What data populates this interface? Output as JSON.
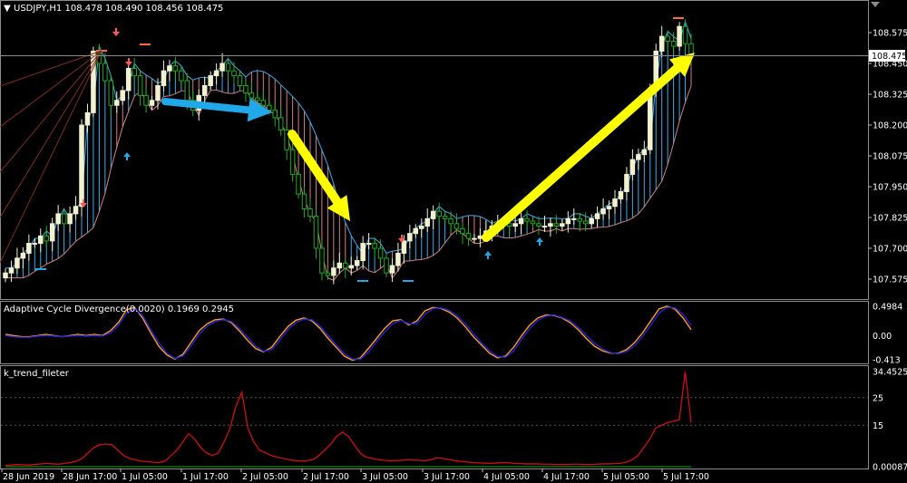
{
  "main": {
    "header": "USDJPY,H1  108.478 108.490 108.456 108.475",
    "price_tag": "108.475",
    "y_ticks": [
      "108.575",
      "108.450",
      "108.325",
      "108.200",
      "108.075",
      "107.950",
      "107.825",
      "107.700",
      "107.575"
    ]
  },
  "acd": {
    "header": "Adaptive Cycle Divergence(0.0020) 0.1969 0.2945",
    "y_ticks": [
      "0.4984",
      "0.00",
      "-0.413"
    ]
  },
  "trend": {
    "header": "k_trend_fileter",
    "y_ticks": [
      "34.4525",
      "25",
      "15",
      "0.00087"
    ]
  },
  "x_ticks": [
    "28 Jun 2019",
    "28 Jun 17:00",
    "1 Jul 05:00",
    "1 Jul 17:00",
    "2 Jul 05:00",
    "2 Jul 17:00",
    "3 Jul 05:00",
    "3 Jul 17:00",
    "4 Jul 05:00",
    "4 Jul 17:00",
    "5 Jul 05:00",
    "5 Jul 17:00"
  ],
  "colors": {
    "background": "#000000",
    "grid": "#646464",
    "text": "#ffffff",
    "bull_candle": "#f2f2d0",
    "bear_candle": "#22aa22",
    "cloud_bull": "#3fa9e6",
    "cloud_bear": "#d08080",
    "acd_fast": "#ff9f1a",
    "acd_slow": "#2222dd",
    "trend_line": "#cc1111",
    "trend_base": "#118811",
    "arrow_blue": "#20a8e8",
    "arrow_yellow": "#ffff00"
  },
  "chart_data": [
    {
      "type": "candlestick",
      "title": "USDJPY,H1",
      "last_price": 108.475,
      "ylim": [
        107.53,
        108.66
      ],
      "closes": [
        107.6,
        107.62,
        107.66,
        107.68,
        107.72,
        107.72,
        107.75,
        107.73,
        107.8,
        107.84,
        107.8,
        107.84,
        107.87,
        108.2,
        108.25,
        108.5,
        108.45,
        108.38,
        108.28,
        108.3,
        108.34,
        108.43,
        108.4,
        108.32,
        108.28,
        108.3,
        108.36,
        108.42,
        108.44,
        108.42,
        108.38,
        108.3,
        108.26,
        108.32,
        108.36,
        108.4,
        108.42,
        108.45,
        108.42,
        108.4,
        108.36,
        108.33,
        108.31,
        108.3,
        108.28,
        108.26,
        108.23,
        108.18,
        108.1,
        108.0,
        107.92,
        107.86,
        107.83,
        107.7,
        107.6,
        107.59,
        107.62,
        107.64,
        107.62,
        107.63,
        107.65,
        107.72,
        107.72,
        107.7,
        107.66,
        107.6,
        107.63,
        107.68,
        107.73,
        107.76,
        107.78,
        107.79,
        107.82,
        107.85,
        107.83,
        107.82,
        107.8,
        107.78,
        107.76,
        107.74,
        107.74,
        107.75,
        107.77,
        107.79,
        107.8,
        107.8,
        107.79,
        107.8,
        107.82,
        107.81,
        107.8,
        107.79,
        107.79,
        107.8,
        107.79,
        107.8,
        107.82,
        107.82,
        107.81,
        107.8,
        107.82,
        107.84,
        107.86,
        107.87,
        107.9,
        107.93,
        108.0,
        108.06,
        108.08,
        108.1,
        108.35,
        108.5,
        108.56,
        108.54,
        108.52,
        108.6,
        108.53,
        108.475
      ]
    },
    {
      "type": "line",
      "title": "Adaptive Cycle Divergence(0.0020)",
      "ylim": [
        -0.413,
        0.4984
      ],
      "series": [
        {
          "values": [
            0.02,
            0.0,
            -0.02,
            -0.02,
            0.0,
            0.02,
            0.0,
            -0.02,
            0.0,
            0.02,
            0.0,
            0.02,
            0.0,
            0.08,
            0.22,
            0.44,
            0.48,
            0.3,
            0.05,
            -0.18,
            -0.33,
            -0.4,
            -0.32,
            -0.12,
            0.08,
            0.2,
            0.27,
            0.28,
            0.22,
            0.08,
            -0.08,
            -0.22,
            -0.28,
            -0.2,
            -0.02,
            0.15,
            0.26,
            0.3,
            0.25,
            0.12,
            -0.05,
            -0.2,
            -0.35,
            -0.42,
            -0.38,
            -0.22,
            -0.05,
            0.12,
            0.25,
            0.27,
            0.18,
            0.25,
            0.42,
            0.48,
            0.46,
            0.4,
            0.3,
            0.15,
            -0.02,
            -0.16,
            -0.3,
            -0.38,
            -0.35,
            -0.2,
            0.0,
            0.18,
            0.3,
            0.35,
            0.34,
            0.3,
            0.22,
            0.1,
            -0.05,
            -0.18,
            -0.26,
            -0.3,
            -0.3,
            -0.24,
            -0.12,
            0.05,
            0.25,
            0.45,
            0.5,
            0.45,
            0.3,
            0.1
          ]
        },
        {
          "values": [
            0.0,
            -0.02,
            -0.03,
            -0.03,
            -0.01,
            0.0,
            -0.01,
            -0.02,
            -0.01,
            0.0,
            -0.01,
            0.0,
            -0.01,
            0.04,
            0.17,
            0.38,
            0.46,
            0.34,
            0.1,
            -0.12,
            -0.3,
            -0.39,
            -0.35,
            -0.18,
            0.02,
            0.16,
            0.24,
            0.27,
            0.24,
            0.12,
            -0.03,
            -0.18,
            -0.27,
            -0.24,
            -0.08,
            0.1,
            0.22,
            0.28,
            0.27,
            0.16,
            0.0,
            -0.16,
            -0.31,
            -0.4,
            -0.4,
            -0.28,
            -0.1,
            0.06,
            0.2,
            0.26,
            0.2,
            0.2,
            0.36,
            0.46,
            0.47,
            0.43,
            0.34,
            0.2,
            0.03,
            -0.12,
            -0.26,
            -0.36,
            -0.37,
            -0.26,
            -0.06,
            0.12,
            0.26,
            0.33,
            0.35,
            0.31,
            0.25,
            0.14,
            0.0,
            -0.13,
            -0.23,
            -0.29,
            -0.31,
            -0.27,
            -0.17,
            -0.01,
            0.18,
            0.38,
            0.48,
            0.47,
            0.36,
            0.17
          ]
        }
      ]
    },
    {
      "type": "line",
      "title": "k_trend_fileter",
      "ylim": [
        0.00087,
        34.4525
      ],
      "series": [
        {
          "values": [
            0.5,
            0.6,
            0.8,
            0.7,
            0.6,
            0.8,
            1.0,
            1.2,
            1.0,
            0.9,
            1.2,
            1.5,
            2,
            3,
            5,
            7,
            8,
            8.2,
            8,
            6,
            4,
            3,
            2.5,
            2,
            1.8,
            1.6,
            1.5,
            2,
            4,
            6,
            9,
            12,
            10,
            7,
            5,
            4,
            5,
            9,
            14,
            22,
            27,
            14,
            9,
            6,
            5,
            4,
            3.5,
            3,
            2.5,
            2.2,
            2,
            2.2,
            2.5,
            4,
            6,
            8,
            11,
            12.5,
            11,
            8,
            5,
            3.5,
            3,
            2.6,
            2.3,
            2.2,
            2.2,
            2.3,
            2.5,
            2.4,
            2.3,
            2.2,
            2.5,
            3.2,
            3,
            2.6,
            2.2,
            1.9,
            1.7,
            1.5,
            1.4,
            1.3,
            1.2,
            1.3,
            1.5,
            1.4,
            1.2,
            1.1,
            1.0,
            1.0,
            1.0,
            0.9,
            0.9,
            0.8,
            0.8,
            0.8,
            0.9,
            0.9,
            0.8,
            0.8,
            0.9,
            1.0,
            1.0,
            1.1,
            1.2,
            1.6,
            2.5,
            4,
            7,
            10,
            14,
            15,
            16,
            16.5,
            17,
            34.4,
            16
          ]
        },
        {
          "values": [
            0,
            0,
            0,
            0,
            0,
            0,
            0,
            0,
            0,
            0,
            0,
            0,
            0,
            0,
            0,
            0,
            0,
            0,
            0,
            0,
            0,
            0,
            0,
            0,
            0,
            0,
            0,
            0,
            0,
            0,
            0,
            0,
            0,
            0,
            0,
            0,
            0,
            0,
            0,
            0,
            0,
            0,
            0,
            0,
            0,
            0,
            0,
            0,
            0,
            0,
            0,
            0,
            0,
            0,
            0,
            0,
            0,
            0,
            0,
            0,
            0,
            0,
            0,
            0,
            0,
            0,
            0,
            0,
            0,
            0,
            0,
            0,
            0,
            0,
            0,
            0,
            0,
            0,
            0,
            0,
            0,
            0,
            0,
            0,
            0,
            0,
            0,
            0,
            0,
            0,
            0,
            0,
            0,
            0,
            0,
            0,
            0,
            0,
            0,
            0,
            0,
            0,
            0,
            0,
            0,
            0,
            0,
            0,
            0,
            0,
            0,
            0,
            0,
            0,
            0,
            0,
            0,
            0,
            0
          ]
        }
      ]
    }
  ]
}
